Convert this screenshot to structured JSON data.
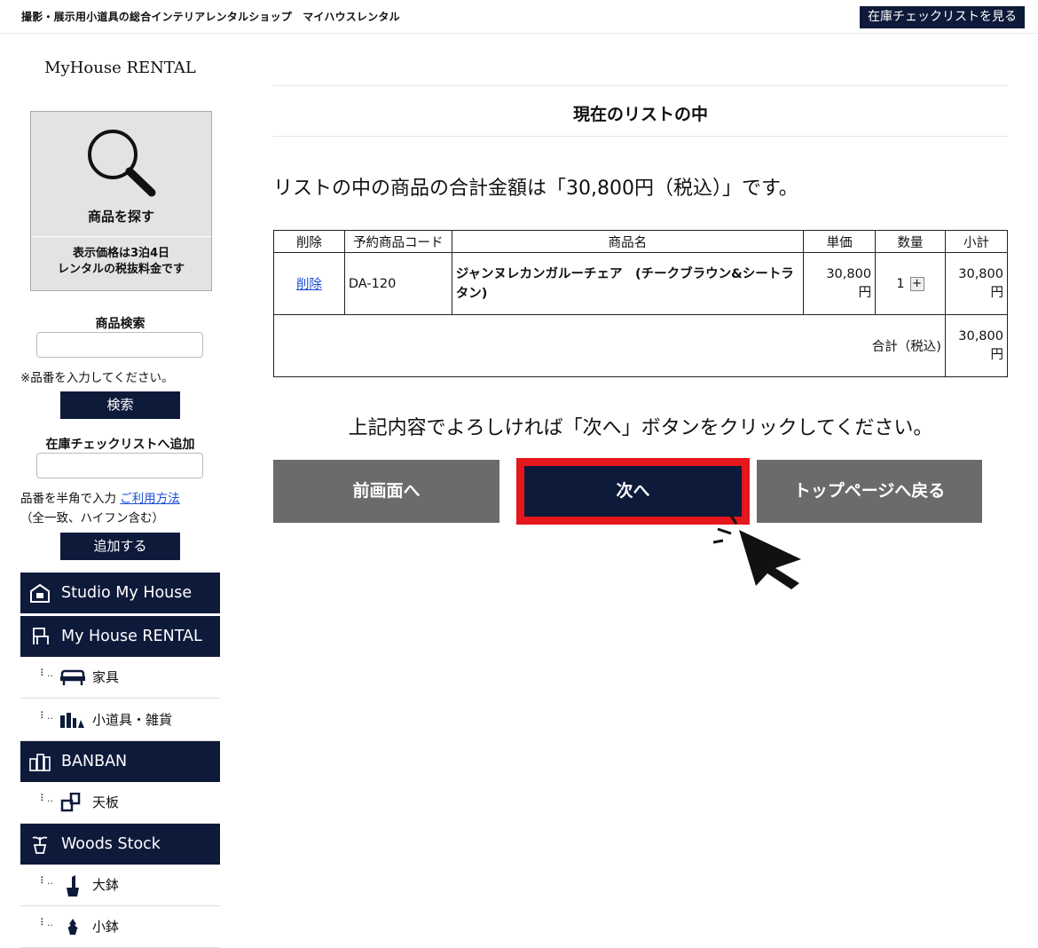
{
  "header": {
    "tagline": "撮影・展示用小道具の総合インテリアレンタルショップ　マイハウスレンタル",
    "stock_list_link": "在庫チェックリストを見る"
  },
  "sidebar": {
    "logo": "MyHouse RENTAL",
    "search_card": {
      "title": "商品を探す",
      "note_line1": "表示価格は3泊4日",
      "note_line2": "レンタルの税抜料金です"
    },
    "product_search": {
      "label": "商品検索",
      "value": "",
      "hint": "※品番を入力してください。",
      "button": "検索"
    },
    "add_stock": {
      "label": "在庫チェックリストへ追加",
      "value": "",
      "hint": "品番を半角で入力",
      "help_link": "ご利用方法",
      "hint2": "（全一致、ハイフン含む）",
      "button": "追加する"
    },
    "categories": [
      {
        "label": "Studio My House",
        "icon": "house-icon"
      },
      {
        "label": "My House RENTAL",
        "icon": "chair-icon",
        "items": [
          {
            "label": "家具",
            "icon": "sofa-icon"
          },
          {
            "label": "小道具・雑貨",
            "icon": "props-icon"
          }
        ]
      },
      {
        "label": "BANBAN",
        "icon": "buildings-icon",
        "items": [
          {
            "label": "天板",
            "icon": "tabletop-icon"
          }
        ]
      },
      {
        "label": "Woods Stock",
        "icon": "plant-icon",
        "items": [
          {
            "label": "大鉢",
            "icon": "large-pot-icon"
          },
          {
            "label": "小鉢",
            "icon": "small-pot-icon"
          }
        ]
      }
    ]
  },
  "main": {
    "title": "現在のリストの中",
    "total_message": "リストの中の商品の合計金額は「30,800円（税込）」です。",
    "table": {
      "headers": [
        "削除",
        "予約商品コード",
        "商品名",
        "単価",
        "数量",
        "小計"
      ],
      "rows": [
        {
          "delete": "削除",
          "code": "DA-120",
          "name": "ジャンヌレカンガルーチェア　(チークブラウン&シートラタン)",
          "price_line1": "30,800",
          "price_line2": "円",
          "qty": "1",
          "subtotal_line1": "30,800",
          "subtotal_line2": "円"
        }
      ],
      "total_label": "合計（税込)",
      "total_line1": "30,800",
      "total_line2": "円"
    },
    "confirm_message": "上記内容でよろしければ「次へ」ボタンをクリックしてください。",
    "buttons": {
      "back": "前画面へ",
      "next": "次へ",
      "top": "トップページへ戻る"
    }
  },
  "colors": {
    "navy": "#0e1a3a",
    "highlight": "#e3171c",
    "gray_button": "#6b6b6b",
    "link": "#1a4fd6"
  }
}
